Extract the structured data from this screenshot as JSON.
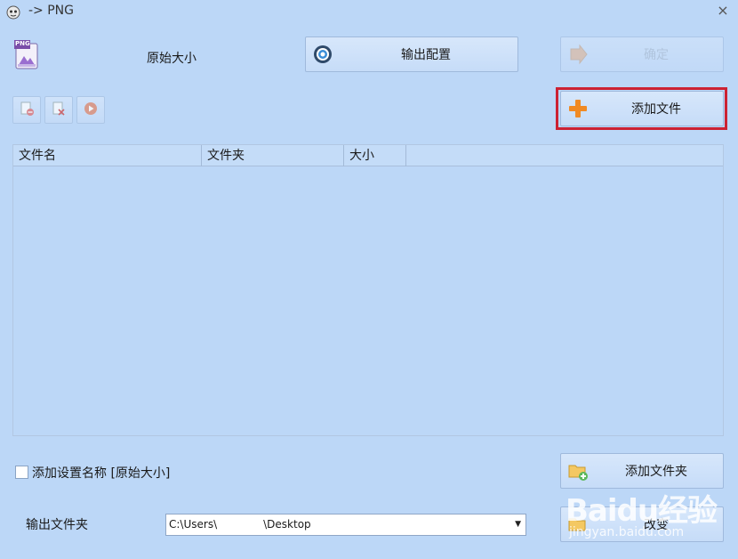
{
  "window": {
    "title": "-> PNG",
    "close_glyph": "×"
  },
  "format": {
    "badge": "PNG",
    "profile_label": "原始大小"
  },
  "toolbar": {
    "output_config_label": "输出配置",
    "confirm_label": "确定",
    "add_file_label": "添加文件"
  },
  "table": {
    "columns": [
      "文件名",
      "文件夹",
      "大小"
    ]
  },
  "bottom": {
    "name_checkbox_label": "添加设置名称 [原始大小]",
    "add_folder_label": "添加文件夹",
    "change_label": "改变",
    "output_folder_label": "输出文件夹",
    "output_path_prefix": "C:\\Users\\",
    "output_path_suffix": "\\Desktop"
  },
  "watermark": {
    "logo": "Baidu经验",
    "url": "jingyan.baidu.com"
  },
  "colors": {
    "background": "#bcd7f7",
    "highlight": "#cc2233",
    "accent_orange": "#f08a24"
  }
}
